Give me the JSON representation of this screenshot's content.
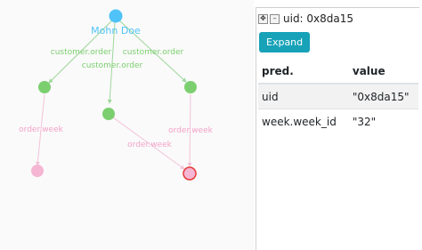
{
  "graph": {
    "root_label": "Mohn Doe",
    "edge_labels": {
      "customer_order_left": "customer.order",
      "customer_order_middle": "customer.order",
      "customer_order_right": "customer.order",
      "order_week_left": "order.week",
      "order_week_middle": "order.week",
      "order_week_right": "order.week"
    },
    "colors": {
      "root_node": "#4fc3f7",
      "root_label": "#4fc3f7",
      "order_node": "#7ccf6f",
      "week_node": "#f4b6d2",
      "selected_border": "#e53935",
      "customer_edge": "#9ed69a",
      "week_edge": "#f4c2d9",
      "customer_label": "#7ccf6f",
      "week_label": "#f4a3c8"
    }
  },
  "panel": {
    "uid_title": "uid: 0x8da15",
    "expand_label": "Expand",
    "icons": [
      "move-icon",
      "minimize-icon"
    ],
    "columns": [
      "pred.",
      "value"
    ],
    "rows": [
      {
        "pred": "uid",
        "value": "\"0x8da15\""
      },
      {
        "pred": "week.week_id",
        "value": "\"32\""
      }
    ],
    "accent_color": "#17a2b8"
  }
}
